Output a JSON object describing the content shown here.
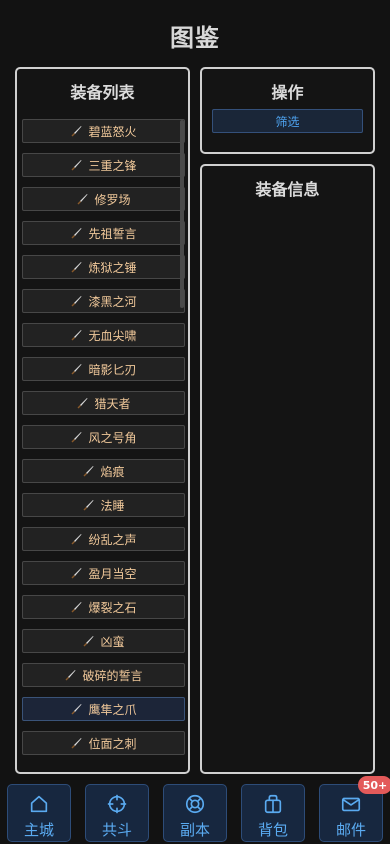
{
  "page": {
    "title": "图鉴"
  },
  "equip_list": {
    "title": "装备列表",
    "items": [
      "碧蓝怒火",
      "三重之锋",
      "修罗场",
      "先祖誓言",
      "炼狱之锤",
      "漆黑之河",
      "无血尖啸",
      "暗影匕刃",
      "猎天者",
      "风之号角",
      "焰痕",
      "法睡",
      "纷乱之声",
      "盈月当空",
      "爆裂之石",
      "凶蛮",
      "破碎的誓言",
      "鹰隼之爪",
      "位面之刺"
    ],
    "selected_index": 17,
    "item_icon": "dagger-icon"
  },
  "operations": {
    "title": "操作",
    "filter_label": "筛选"
  },
  "equip_info": {
    "title": "装备信息"
  },
  "nav": {
    "items": [
      {
        "label": "主城",
        "icon": "home-icon"
      },
      {
        "label": "共斗",
        "icon": "crosshair-icon"
      },
      {
        "label": "副本",
        "icon": "lifebuoy-icon"
      },
      {
        "label": "背包",
        "icon": "bag-icon"
      },
      {
        "label": "邮件",
        "icon": "mail-icon"
      }
    ],
    "mail_badge": "50+"
  },
  "colors": {
    "accent": "#5aaaf0",
    "item_text": "#f0c89a",
    "badge": "#e35a5a"
  }
}
